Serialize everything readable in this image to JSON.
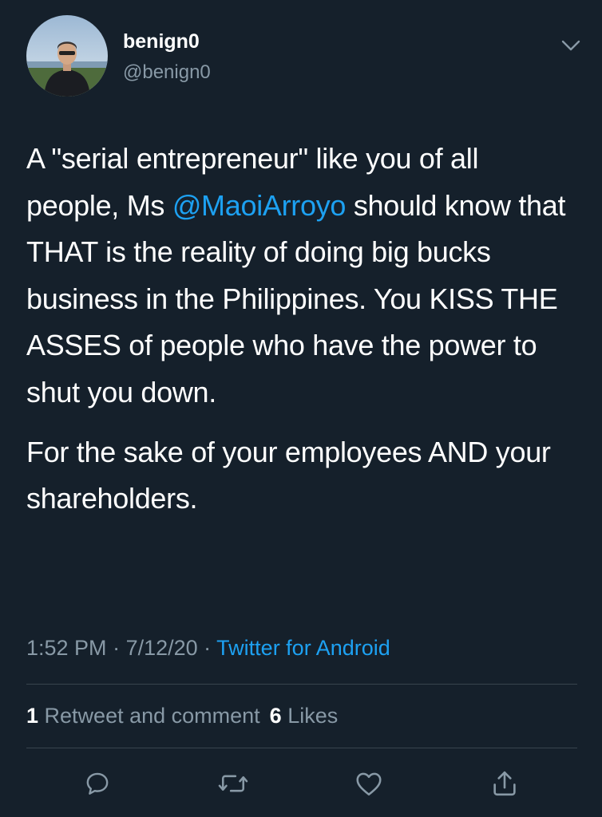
{
  "author": {
    "display_name": "benign0",
    "handle": "@benign0"
  },
  "tweet": {
    "p1_part1": "A \"serial entrepreneur\" like you of all people, Ms ",
    "mention": "@MaoiArroyo",
    "p1_part2": " should know that THAT is the reality of doing big bucks business in the Philippines. You KISS THE ASSES of people who have the power to shut you down.",
    "p2": "For the sake of your employees AND your shareholders."
  },
  "meta": {
    "time": "1:52 PM",
    "sep1": " · ",
    "date": "7/12/20",
    "sep2": " · ",
    "source": "Twitter for Android"
  },
  "stats": {
    "retweets_count": "1",
    "retweets_label": " Retweet and comment",
    "likes_count": "6",
    "likes_label": " Likes"
  },
  "icons": {
    "caret": "chevron-down-icon",
    "reply": "reply-icon",
    "retweet": "retweet-icon",
    "like": "heart-icon",
    "share": "share-icon"
  },
  "colors": {
    "background": "#15202b",
    "accent": "#1da1f2",
    "secondary_text": "#8899a6",
    "divider": "#38444d"
  }
}
